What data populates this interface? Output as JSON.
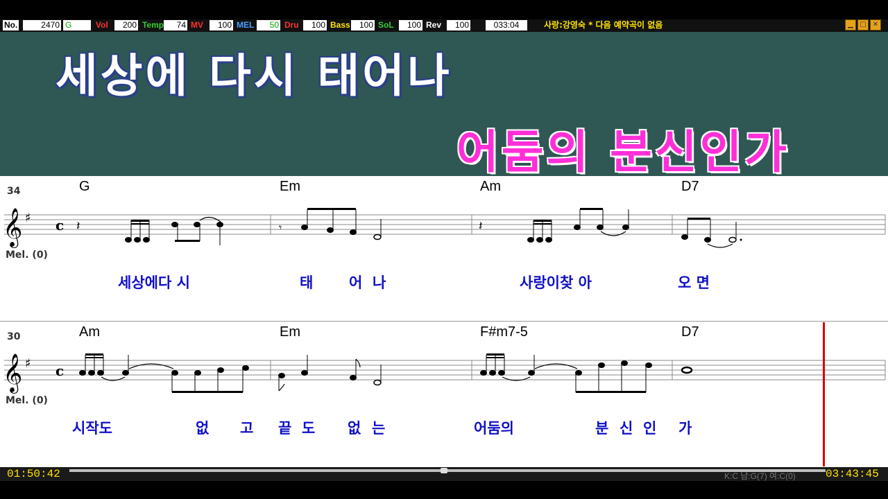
{
  "status_bar": {
    "no_label": "No.",
    "no_value": "2470",
    "key_value": "G",
    "vol_label": "Vol",
    "vol_value": "200",
    "tempo_label": "Temp",
    "tempo_value": "74",
    "mv_label": "MV",
    "mv_value": "100",
    "mel_label": "MEL",
    "mel_value": "50",
    "dru_label": "Dru",
    "dru_value": "100",
    "bass_label": "Bass",
    "bass_value": "100",
    "sol_label": "SoL",
    "sol_value": "100",
    "rev_label": "Rev",
    "rev_value": "100",
    "elapsed_counter": "033:04",
    "marquee": "사랑:강영숙 * 다음 예약곡이 없음"
  },
  "song": {
    "title": "세상에 다시 태어나",
    "artist": "어둠의 분신인가"
  },
  "systems": [
    {
      "measure_number": "34",
      "track_label": "Mel. (0)",
      "chords": [
        "G",
        "Em",
        "Am",
        "D7"
      ],
      "lyrics": [
        "세상에다 시",
        "태",
        "어",
        "나",
        "사랑이찾 아",
        "오 면"
      ]
    },
    {
      "measure_number": "30",
      "track_label": "Mel. (0)",
      "chords": [
        "Am",
        "Em",
        "F#m7-5",
        "D7"
      ],
      "lyrics": [
        "시작도",
        "없",
        "고",
        "끝",
        "도",
        "없",
        "는",
        "어둠의",
        "분",
        "신",
        "인",
        "가"
      ]
    }
  ],
  "playback": {
    "current_time": "01:50:42",
    "total_time": "03:43:45",
    "key_info": "K:C 남:G(7) 여:C(0)",
    "progress_fraction": 0.495
  },
  "colors": {
    "title_panel": "#2f5753",
    "title_text": "#ffffff",
    "artist_text": "#ff2fd8",
    "lyric_text": "#1010c8",
    "cursor": "#d40000",
    "time_text": "#ffe400"
  }
}
